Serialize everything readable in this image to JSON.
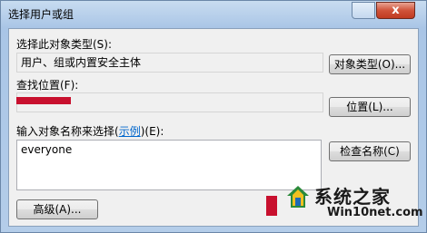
{
  "window": {
    "title": "选择用户或组",
    "close_label": "x"
  },
  "object_type": {
    "label": "选择此对象类型(S):",
    "value": "用户、组或内置安全主体",
    "button": "对象类型(O)..."
  },
  "location": {
    "label": "查找位置(F):",
    "button": "位置(L)..."
  },
  "names": {
    "label_prefix": "输入对象名称来选择(",
    "label_link": "示例",
    "label_suffix": ")(E):",
    "value": "everyone",
    "check_button": "检查名称(C)"
  },
  "footer": {
    "advanced_button": "高级(A)..."
  },
  "watermark": {
    "brand": "系统之家",
    "site": "Win10net.com"
  },
  "colors": {
    "redacted": "#c8102e",
    "link": "#0066cc"
  }
}
